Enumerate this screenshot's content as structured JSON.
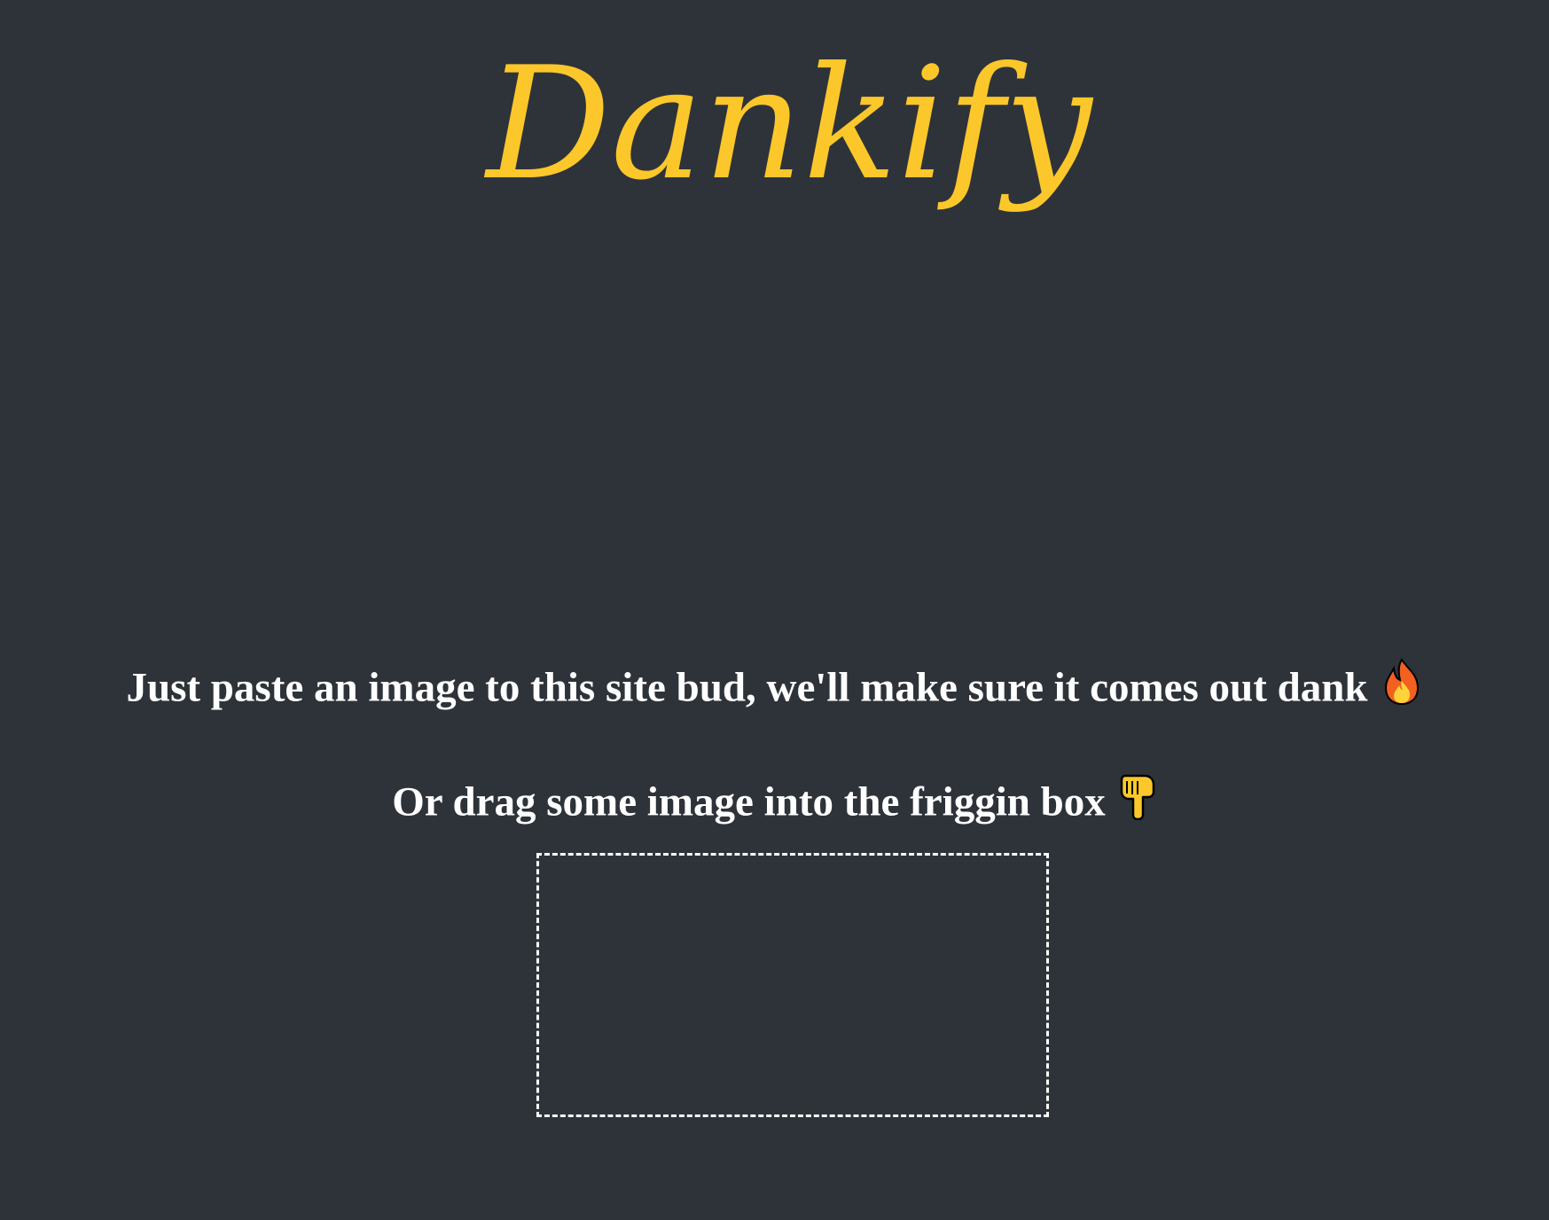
{
  "brand": {
    "name": "Dankify",
    "color": "#fcc72a"
  },
  "colors": {
    "background": "#2e333a",
    "text": "#ffffff"
  },
  "instructions": {
    "paste_text": "Just paste an image to this site bud, we'll make sure it comes out dank",
    "paste_icon": "fire-icon",
    "drag_text": "Or drag some image into the friggin box",
    "drag_icon": "pointing-down-hand-icon"
  },
  "dropzone": {
    "label": "image drop box"
  }
}
